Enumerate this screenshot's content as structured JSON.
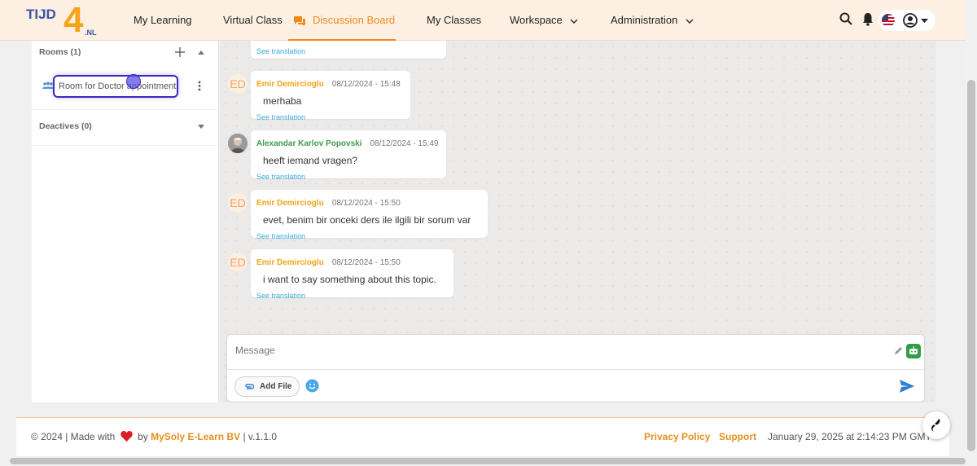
{
  "nav": {
    "my_learning": "My Learning",
    "virtual_class": "Virtual Class",
    "discussion_board": "Discussion Board",
    "my_classes": "My Classes",
    "workspace": "Workspace",
    "administration": "Administration"
  },
  "accent_color": "#f08a1a",
  "rooms": {
    "label": "Rooms (1)",
    "items": [
      {
        "name": "Room for Doctor appointment"
      }
    ],
    "deactives_label": "Deactives (0)"
  },
  "messages": [
    {
      "sender": "Emir Demircioglu",
      "initials": "ED",
      "time": "08/12/2024 - 15:48",
      "text": "merhaba",
      "translate": "See translation"
    },
    {
      "sender": "Alexandar Karlov Popovski",
      "initials": "",
      "time": "08/12/2024 - 15:49",
      "text": "heeft iemand vragen?",
      "translate": "See translation"
    },
    {
      "sender": "Emir Demircioglu",
      "initials": "ED",
      "time": "08/12/2024 - 15:50",
      "text": "evet, benim bir onceki ders ile ilgili bir sorum var",
      "translate": "See translation"
    },
    {
      "sender": "Emir Demircioglu",
      "initials": "ED",
      "time": "08/12/2024 - 15:50",
      "text": "i want to say something about this topic.",
      "translate": "See translation"
    }
  ],
  "top_partial_translate": "See translation",
  "composer": {
    "placeholder": "Message",
    "add_file": "Add File"
  },
  "footer": {
    "copyright": "© 2024 | Made with",
    "by": "by",
    "brand": "MySoly E-Learn BV",
    "version": "| v.1.1.0",
    "privacy": "Privacy Policy",
    "support": "Support",
    "datetime": "January 29, 2025 at 2:14:23 PM GMT"
  }
}
